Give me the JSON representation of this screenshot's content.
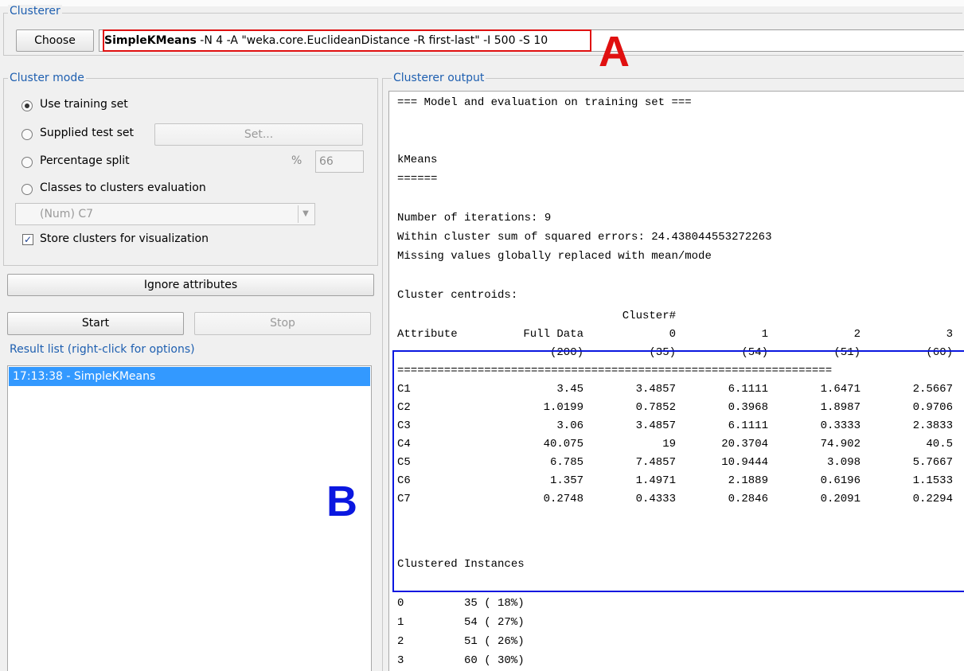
{
  "clusterer": {
    "title": "Clusterer",
    "choose_label": "Choose",
    "algorithm_name": "SimpleKMeans",
    "options": " -N 4 -A \"weka.core.EuclideanDistance -R first-last\" -I 500 -S 10"
  },
  "cluster_mode": {
    "title": "Cluster mode",
    "use_training_label": "Use training set",
    "supplied_test_label": "Supplied test set",
    "set_button_label": "Set...",
    "percentage_split_label": "Percentage split",
    "percent_sign": "%",
    "percentage_value": "66",
    "classes_to_clusters_label": "Classes to clusters evaluation",
    "class_select_value": "(Num) C7",
    "store_clusters_label": "Store clusters for visualization",
    "selected_mode": "use_training_set",
    "store_clusters_checked": true
  },
  "ignore_attributes_label": "Ignore attributes",
  "start_label": "Start",
  "stop_label": "Stop",
  "result_list": {
    "title": "Result list (right-click for options)",
    "items": [
      "17:13:38 - SimpleKMeans"
    ]
  },
  "output": {
    "title": "Clusterer output",
    "header_line": "=== Model and evaluation on training set ===",
    "algo": "kMeans",
    "algo_underline": "======",
    "iterations": "Number of iterations: 9",
    "sse": "Within cluster sum of squared errors: 24.438044553272263",
    "missing": "Missing values globally replaced with mean/mode",
    "centroids_title": "Cluster centroids:",
    "cluster_hash": "Cluster#",
    "table_header": [
      "Attribute",
      "Full Data",
      "0",
      "1",
      "2",
      "3"
    ],
    "table_counts": [
      "(200)",
      "(35)",
      "(54)",
      "(51)",
      "(60)"
    ],
    "separator": "=================================================================",
    "rows": [
      [
        "C1",
        "3.45",
        "3.4857",
        "6.1111",
        "1.6471",
        "2.5667"
      ],
      [
        "C2",
        "1.0199",
        "0.7852",
        "0.3968",
        "1.8987",
        "0.9706"
      ],
      [
        "C3",
        "3.06",
        "3.4857",
        "6.1111",
        "0.3333",
        "2.3833"
      ],
      [
        "C4",
        "40.075",
        "19",
        "20.3704",
        "74.902",
        "40.5"
      ],
      [
        "C5",
        "6.785",
        "7.4857",
        "10.9444",
        "3.098",
        "5.7667"
      ],
      [
        "C6",
        "1.357",
        "1.4971",
        "2.1889",
        "0.6196",
        "1.1533"
      ],
      [
        "C7",
        "0.2748",
        "0.4333",
        "0.2846",
        "0.2091",
        "0.2294"
      ]
    ],
    "clustered_title": "Clustered Instances",
    "instances": [
      [
        "0",
        "35 ( 18%)"
      ],
      [
        "1",
        "54 ( 27%)"
      ],
      [
        "2",
        "51 ( 26%)"
      ],
      [
        "3",
        "60 ( 30%)"
      ]
    ]
  },
  "annotations": {
    "a": "A",
    "b": "B",
    "a_color": "#e01010",
    "b_color": "#0a17e0"
  }
}
